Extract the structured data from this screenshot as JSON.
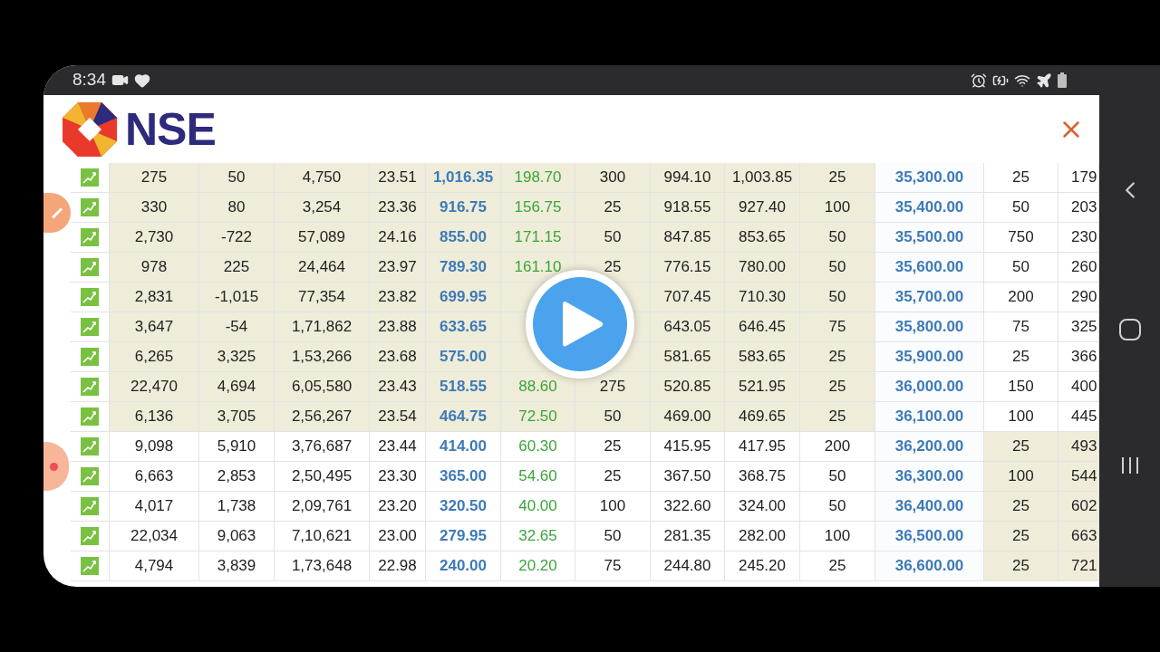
{
  "status_bar": {
    "time": "8:34"
  },
  "header": {
    "logo_text": "NSE"
  },
  "table": {
    "rows": [
      {
        "call_itm": true,
        "put_itm": false,
        "cells": [
          "275",
          "50",
          "4,750",
          "23.51",
          "1,016.35",
          "198.70",
          "300",
          "994.10",
          "1,003.85",
          "25",
          "35,300.00",
          "25",
          "179"
        ]
      },
      {
        "call_itm": true,
        "put_itm": false,
        "cells": [
          "330",
          "80",
          "3,254",
          "23.36",
          "916.75",
          "156.75",
          "25",
          "918.55",
          "927.40",
          "100",
          "35,400.00",
          "50",
          "203"
        ]
      },
      {
        "call_itm": true,
        "put_itm": false,
        "cells": [
          "2,730",
          "-722",
          "57,089",
          "24.16",
          "855.00",
          "171.15",
          "50",
          "847.85",
          "853.65",
          "50",
          "35,500.00",
          "750",
          "230"
        ]
      },
      {
        "call_itm": true,
        "put_itm": false,
        "cells": [
          "978",
          "225",
          "24,464",
          "23.97",
          "789.30",
          "161.10",
          "25",
          "776.15",
          "780.00",
          "50",
          "35,600.00",
          "50",
          "260"
        ]
      },
      {
        "call_itm": true,
        "put_itm": false,
        "cells": [
          "2,831",
          "-1,015",
          "77,354",
          "23.82",
          "699.95",
          null,
          null,
          "707.45",
          "710.30",
          "50",
          "35,700.00",
          "200",
          "290"
        ]
      },
      {
        "call_itm": true,
        "put_itm": false,
        "cells": [
          "3,647",
          "-54",
          "1,71,862",
          "23.88",
          "633.65",
          null,
          null,
          "643.05",
          "646.45",
          "75",
          "35,800.00",
          "75",
          "325"
        ]
      },
      {
        "call_itm": true,
        "put_itm": false,
        "cells": [
          "6,265",
          "3,325",
          "1,53,266",
          "23.68",
          "575.00",
          null,
          null,
          "581.65",
          "583.65",
          "25",
          "35,900.00",
          "25",
          "366"
        ]
      },
      {
        "call_itm": true,
        "put_itm": false,
        "cells": [
          "22,470",
          "4,694",
          "6,05,580",
          "23.43",
          "518.55",
          "88.60",
          "275",
          "520.85",
          "521.95",
          "25",
          "36,000.00",
          "150",
          "400"
        ]
      },
      {
        "call_itm": true,
        "put_itm": false,
        "cells": [
          "6,136",
          "3,705",
          "2,56,267",
          "23.54",
          "464.75",
          "72.50",
          "50",
          "469.00",
          "469.65",
          "25",
          "36,100.00",
          "100",
          "445"
        ]
      },
      {
        "call_itm": false,
        "put_itm": true,
        "cells": [
          "9,098",
          "5,910",
          "3,76,687",
          "23.44",
          "414.00",
          "60.30",
          "25",
          "415.95",
          "417.95",
          "200",
          "36,200.00",
          "25",
          "493"
        ]
      },
      {
        "call_itm": false,
        "put_itm": true,
        "cells": [
          "6,663",
          "2,853",
          "2,50,495",
          "23.30",
          "365.00",
          "54.60",
          "25",
          "367.50",
          "368.75",
          "50",
          "36,300.00",
          "100",
          "544"
        ]
      },
      {
        "call_itm": false,
        "put_itm": true,
        "cells": [
          "4,017",
          "1,738",
          "2,09,761",
          "23.20",
          "320.50",
          "40.00",
          "100",
          "322.60",
          "324.00",
          "50",
          "36,400.00",
          "25",
          "602"
        ]
      },
      {
        "call_itm": false,
        "put_itm": true,
        "cells": [
          "22,034",
          "9,063",
          "7,10,621",
          "23.00",
          "279.95",
          "32.65",
          "50",
          "281.35",
          "282.00",
          "100",
          "36,500.00",
          "25",
          "663"
        ]
      },
      {
        "call_itm": false,
        "put_itm": true,
        "cells": [
          "4,794",
          "3,839",
          "1,73,648",
          "22.98",
          "240.00",
          "20.20",
          "75",
          "244.80",
          "245.20",
          "25",
          "36,600.00",
          "25",
          "721"
        ]
      }
    ]
  }
}
